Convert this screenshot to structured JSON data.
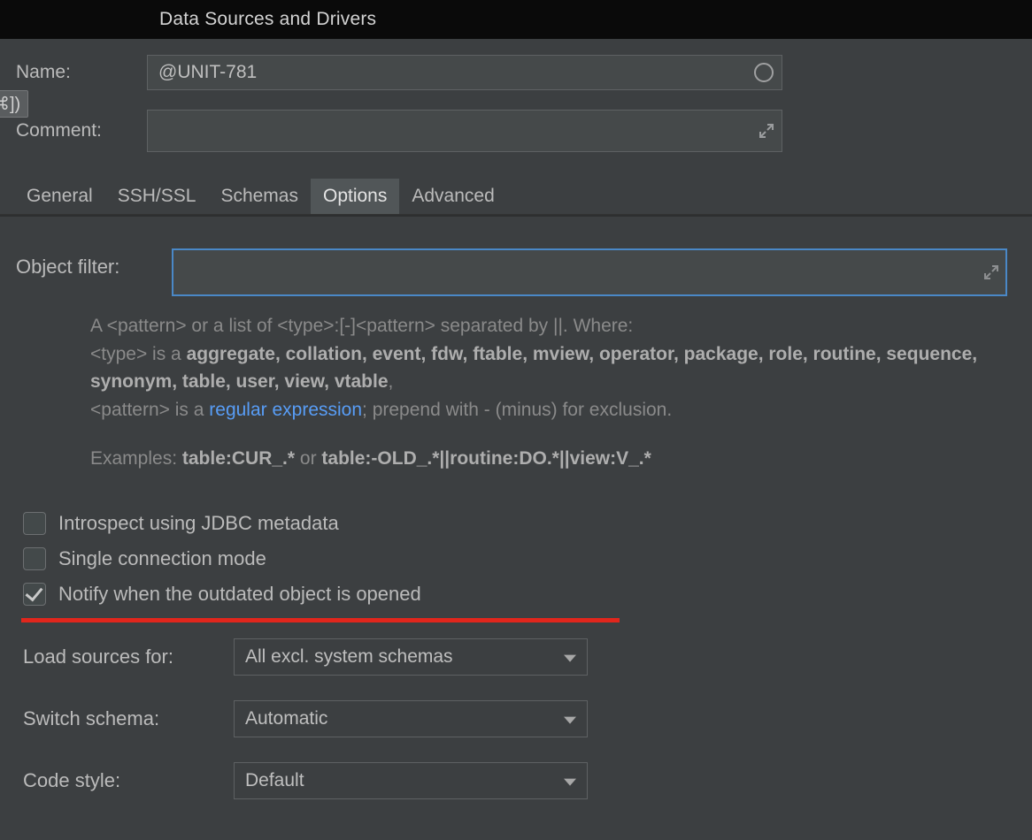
{
  "window": {
    "title": "Data Sources and Drivers"
  },
  "form": {
    "name_label": "Name:",
    "name_value": "@UNIT-781",
    "comment_label": "Comment:",
    "comment_value": "",
    "shortcut_hint": "⌘])"
  },
  "tabs": {
    "general": "General",
    "sshssl": "SSH/SSL",
    "schemas": "Schemas",
    "options": "Options",
    "advanced": "Advanced"
  },
  "options": {
    "object_filter_label": "Object filter:",
    "object_filter_value": "",
    "hint_line1_prefix": "A <pattern> or a list of <type>:[-]<pattern> separated by ||. Where:",
    "hint_line2_prefix": "<type> is a ",
    "hint_types": "aggregate, collation, event, fdw, ftable, mview, operator, package, role, routine, sequence, synonym, table, user, view, vtable",
    "hint_types_trailing": ",",
    "hint_line3_prefix": "<pattern> is a ",
    "hint_regex_link": "regular expression",
    "hint_line3_suffix": "; prepend with - (minus) for exclusion.",
    "hint_examples_prefix": "Examples: ",
    "hint_example1": "table:CUR_.*",
    "hint_or": " or ",
    "hint_example2": "table:-OLD_.*||routine:DO.*||view:V_.*",
    "check_introspect": "Introspect using JDBC metadata",
    "check_single": "Single connection mode",
    "check_notify": "Notify when the outdated object is opened",
    "load_sources_label": "Load sources for:",
    "load_sources_value": "All excl. system schemas",
    "switch_schema_label": "Switch schema:",
    "switch_schema_value": "Automatic",
    "code_style_label": "Code style:",
    "code_style_value": "Default"
  }
}
